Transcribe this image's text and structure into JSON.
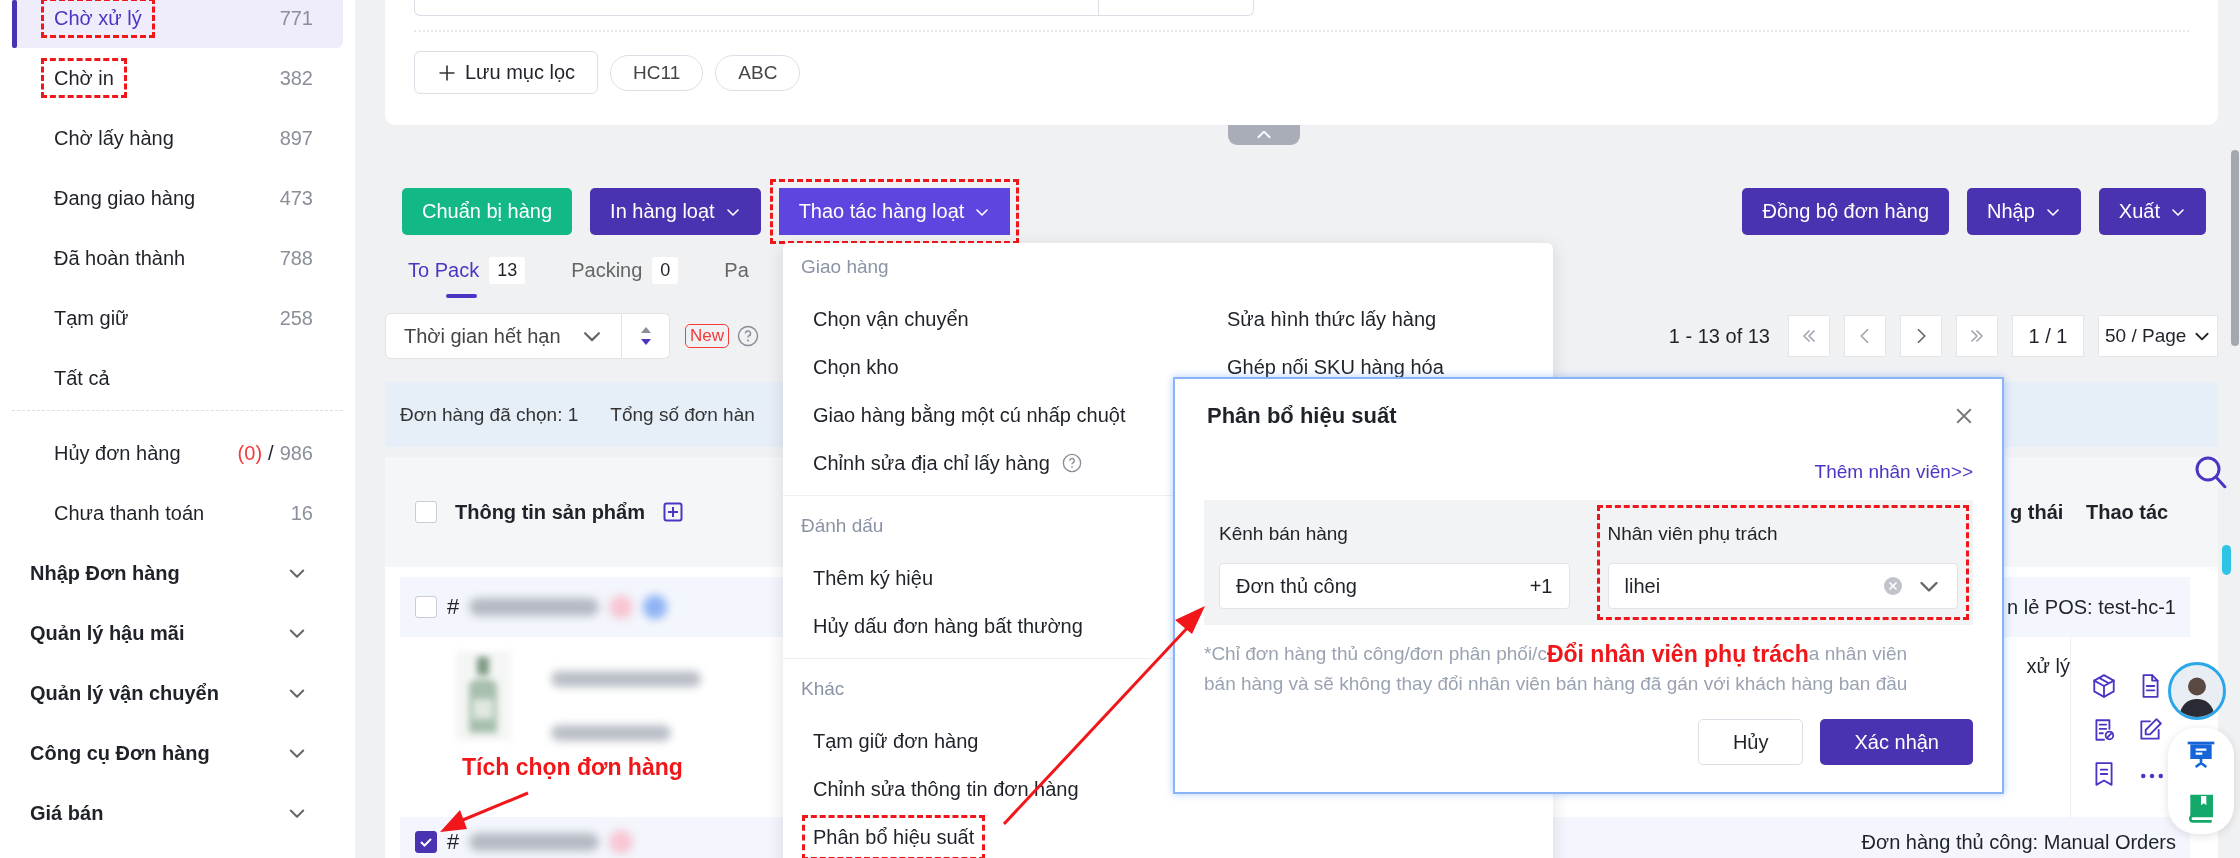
{
  "sidebar": {
    "items": [
      {
        "kind": "status",
        "label": "Chờ xử lý",
        "count": "771",
        "selected": true,
        "highlighted": true
      },
      {
        "kind": "status",
        "label": "Chờ in",
        "count": "382",
        "selected": false,
        "highlighted": true
      },
      {
        "kind": "status",
        "label": "Chờ lấy hàng",
        "count": "897",
        "selected": false,
        "highlighted": false
      },
      {
        "kind": "status",
        "label": "Đang giao hàng",
        "count": "473",
        "selected": false,
        "highlighted": false
      },
      {
        "kind": "status",
        "label": "Đã hoàn thành",
        "count": "788",
        "selected": false,
        "highlighted": false
      },
      {
        "kind": "status",
        "label": "Tạm giữ",
        "count": "258",
        "selected": false,
        "highlighted": false
      },
      {
        "kind": "status",
        "label": "Tất cả",
        "selected": false,
        "highlighted": false
      },
      {
        "kind": "divider"
      },
      {
        "kind": "status",
        "label": "Hủy đơn hàng",
        "alert_count": "(0)",
        "separator": "/",
        "count": "986",
        "selected": false,
        "highlighted": false
      },
      {
        "kind": "status",
        "label": "Chưa thanh toán",
        "count": "16",
        "selected": false,
        "highlighted": false
      },
      {
        "kind": "group",
        "label": "Nhập Đơn hàng",
        "expanded": false
      },
      {
        "kind": "group",
        "label": "Quản lý hậu mãi",
        "expanded": false
      },
      {
        "kind": "group",
        "label": "Quản lý vận chuyển",
        "expanded": false
      },
      {
        "kind": "group",
        "label": "Công cụ Đơn hàng",
        "expanded": false
      },
      {
        "kind": "group",
        "label": "Giá bán",
        "expanded": false
      }
    ]
  },
  "filter_panel": {
    "save_filter": "Lưu mục lọc",
    "chips": [
      "HC11",
      "ABC"
    ]
  },
  "toolbar": {
    "left": [
      {
        "label": "Chuẩn bị hàng",
        "kind": "success",
        "dropdown": false,
        "highlighted": false
      },
      {
        "label": "In hàng loạt",
        "kind": "primary",
        "dropdown": true,
        "highlighted": false
      },
      {
        "label": "Thao tác hàng loạt",
        "kind": "accent",
        "dropdown": true,
        "highlighted": true
      }
    ],
    "right": [
      {
        "label": "Đồng bộ đơn hàng",
        "kind": "primary",
        "dropdown": false,
        "highlighted": false
      },
      {
        "label": "Nhập",
        "kind": "primary",
        "dropdown": true,
        "highlighted": false
      },
      {
        "label": "Xuất",
        "kind": "primary",
        "dropdown": true,
        "highlighted": false
      }
    ]
  },
  "tabs": [
    {
      "label": "To Pack",
      "count": "13",
      "selected": true
    },
    {
      "label": "Packing",
      "count": "0",
      "selected": false
    },
    {
      "label": "Pa",
      "selected": false
    }
  ],
  "sort": {
    "field": "Thời gian hết hạn",
    "badge": "New"
  },
  "pagination": {
    "range": "1 - 13 of 13",
    "page": "1 / 1",
    "page_size": "50 / Page"
  },
  "selection_bar": [
    "Đơn hàng đã chọn: 1",
    "Tổng số đơn hàn"
  ],
  "table": {
    "all_checked": false,
    "columns": [
      "Thông tin sản phẩm",
      "g thái",
      "Thao tác"
    ],
    "rows": [
      {
        "checked": false,
        "hash": "#",
        "channel": "n lẻ POS: test-hc-1",
        "status": "xử lý"
      },
      {
        "checked": true,
        "hash": "#",
        "channel": "Đơn hàng thủ công: Manual Orders"
      }
    ]
  },
  "row_callout": "Tích chọn đơn hàng",
  "bulk_menu": {
    "sections": [
      {
        "title": "Giao hàng",
        "columns": [
          [
            {
              "label": "Chọn vận chuyển",
              "help": false,
              "highlighted": false
            },
            {
              "label": "Chọn kho",
              "help": false,
              "highlighted": false
            },
            {
              "label": "Giao hàng bằng một cú nhấp chuột",
              "help": false,
              "highlighted": false
            },
            {
              "label": "Chỉnh sửa địa chỉ lấy hàng",
              "help": true,
              "highlighted": false
            }
          ],
          [
            {
              "label": "Sửa hình thức lấy hàng",
              "help": false,
              "highlighted": false
            },
            {
              "label": "Ghép nối SKU hàng hóa",
              "help": false,
              "highlighted": false
            }
          ]
        ]
      },
      {
        "title": "Đánh dấu",
        "columns": [
          [
            {
              "label": "Thêm ký hiệu",
              "help": false,
              "highlighted": false
            },
            {
              "label": "Hủy dấu đơn hàng bất thường",
              "help": false,
              "highlighted": false
            }
          ]
        ]
      },
      {
        "title": "Khác",
        "columns": [
          [
            {
              "label": "Tạm giữ đơn hàng",
              "help": false,
              "highlighted": false
            },
            {
              "label": "Chỉnh sửa thông tin đơn hàng",
              "help": false,
              "highlighted": false
            },
            {
              "label": "Phân bổ hiệu suất",
              "help": false,
              "highlighted": true
            }
          ]
        ]
      }
    ]
  },
  "modal": {
    "title": "Phân bổ hiệu suất",
    "link": "Thêm nhân viên>>",
    "fields": [
      {
        "label": "Kênh bán hàng",
        "value": "Đơn thủ công",
        "extra": "+1",
        "clearable": false,
        "highlighted": false
      },
      {
        "label": "Nhân viên phụ trách",
        "value": "lihei",
        "clearable": true,
        "highlighted": true
      }
    ],
    "note_start": "*Chỉ đơn hàng thủ công/đơn phân phối/c",
    "callout": "Đổi nhân viên phụ trách",
    "note_end": "a nhân viên",
    "note_line2": "bán hàng và sẽ không thay đổi nhân viên bán hàng đã gán với khách hàng ban đầu",
    "buttons": [
      {
        "label": "Hủy",
        "kind": "secondary"
      },
      {
        "label": "Xác nhận",
        "kind": "primary"
      }
    ]
  }
}
